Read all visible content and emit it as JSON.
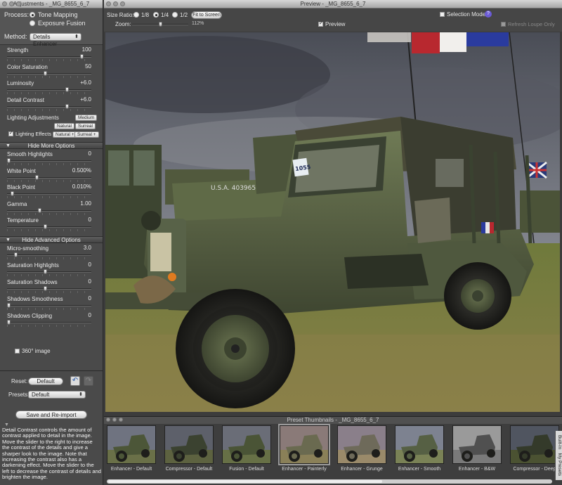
{
  "adjustments": {
    "window_title": "Adjustments - _MG_8655_6_7",
    "process_label": "Process:",
    "process_options": [
      "Tone Mapping",
      "Exposure Fusion"
    ],
    "process_selected": "Tone Mapping",
    "method_label": "Method:",
    "method_value": "Details Enhancer",
    "sliders": [
      {
        "name": "Strength",
        "value": "100",
        "level": 1.0
      },
      {
        "name": "Color Saturation",
        "value": "50",
        "level": 0.5
      },
      {
        "name": "Luminosity",
        "value": "+6.0",
        "level": 0.8
      },
      {
        "name": "Detail Contrast",
        "value": "+6.0",
        "level": 0.8
      }
    ],
    "lighting": {
      "title": "Lighting Adjustments",
      "medium": "Medium",
      "natural": "Natural",
      "surreal": "Surreal",
      "effects_label": "Lighting Effects",
      "effects_checked": true,
      "natural_plus": "Natural +",
      "surreal_plus": "Surreal +"
    },
    "more_options_header": "Hide More Options",
    "more_sliders": [
      {
        "name": "Smooth Highlights",
        "value": "0",
        "level": 0.0
      },
      {
        "name": "White Point",
        "value": "0.500%",
        "level": 0.38
      },
      {
        "name": "Black Point",
        "value": "0.010%",
        "level": 0.05
      },
      {
        "name": "Gamma",
        "value": "1.00",
        "level": 0.42
      },
      {
        "name": "Temperature",
        "value": "0",
        "level": 0.5
      }
    ],
    "advanced_header": "Hide Advanced Options",
    "advanced_sliders": [
      {
        "name": "Micro-smoothing",
        "value": "3.0",
        "level": 0.1
      },
      {
        "name": "Saturation Highlights",
        "value": "0",
        "level": 0.5
      },
      {
        "name": "Saturation Shadows",
        "value": "0",
        "level": 0.5
      },
      {
        "name": "Shadows Smoothness",
        "value": "0",
        "level": 0.0
      },
      {
        "name": "Shadows Clipping",
        "value": "0",
        "level": 0.0
      }
    ],
    "image360_label": "360° image",
    "reset_label": "Reset:",
    "reset_button": "Default",
    "presets_label": "Presets:",
    "presets_value": "Default",
    "save_button": "Save and Re-import",
    "help_text": "Detail Contrast controls the amount of contrast applied to detail in the image. Move the slider to the right to increase the contrast of the details and give a sharper look to the image. Note that increasing the contrast also has a darkening effect. Move the slider to the left to decrease the contrast of details and brighten the image."
  },
  "preview": {
    "window_title": "Preview - _MG_8655_6_7",
    "size_ratio_label": "Size Ratio:",
    "ratios": [
      "1/8",
      "1/4",
      "1/2"
    ],
    "ratio_selected": "1/4",
    "fit_button": "Fit to Screen",
    "zoom_label": "Zoom:",
    "zoom_value": "112%",
    "preview_checkbox": "Preview",
    "selection_mode": "Selection Mode",
    "help_icon": "?",
    "refresh_loupe": "Refresh Loupe Only",
    "plate_text": "U.S.A. 4039655",
    "number_plate": "1055"
  },
  "thumbnails": {
    "title": "Preset Thumbnails - _MG_8655_6_7",
    "items": [
      {
        "label": "Enhancer - Default"
      },
      {
        "label": "Compressor - Default"
      },
      {
        "label": "Fusion - Default"
      },
      {
        "label": "Enhancer - Painterly"
      },
      {
        "label": "Enhancer - Grunge"
      },
      {
        "label": "Enhancer - Smooth"
      },
      {
        "label": "Enhancer - B&W"
      },
      {
        "label": "Compressor - Deep"
      }
    ],
    "side_tabs": [
      "Built-In",
      "My Presets"
    ]
  }
}
